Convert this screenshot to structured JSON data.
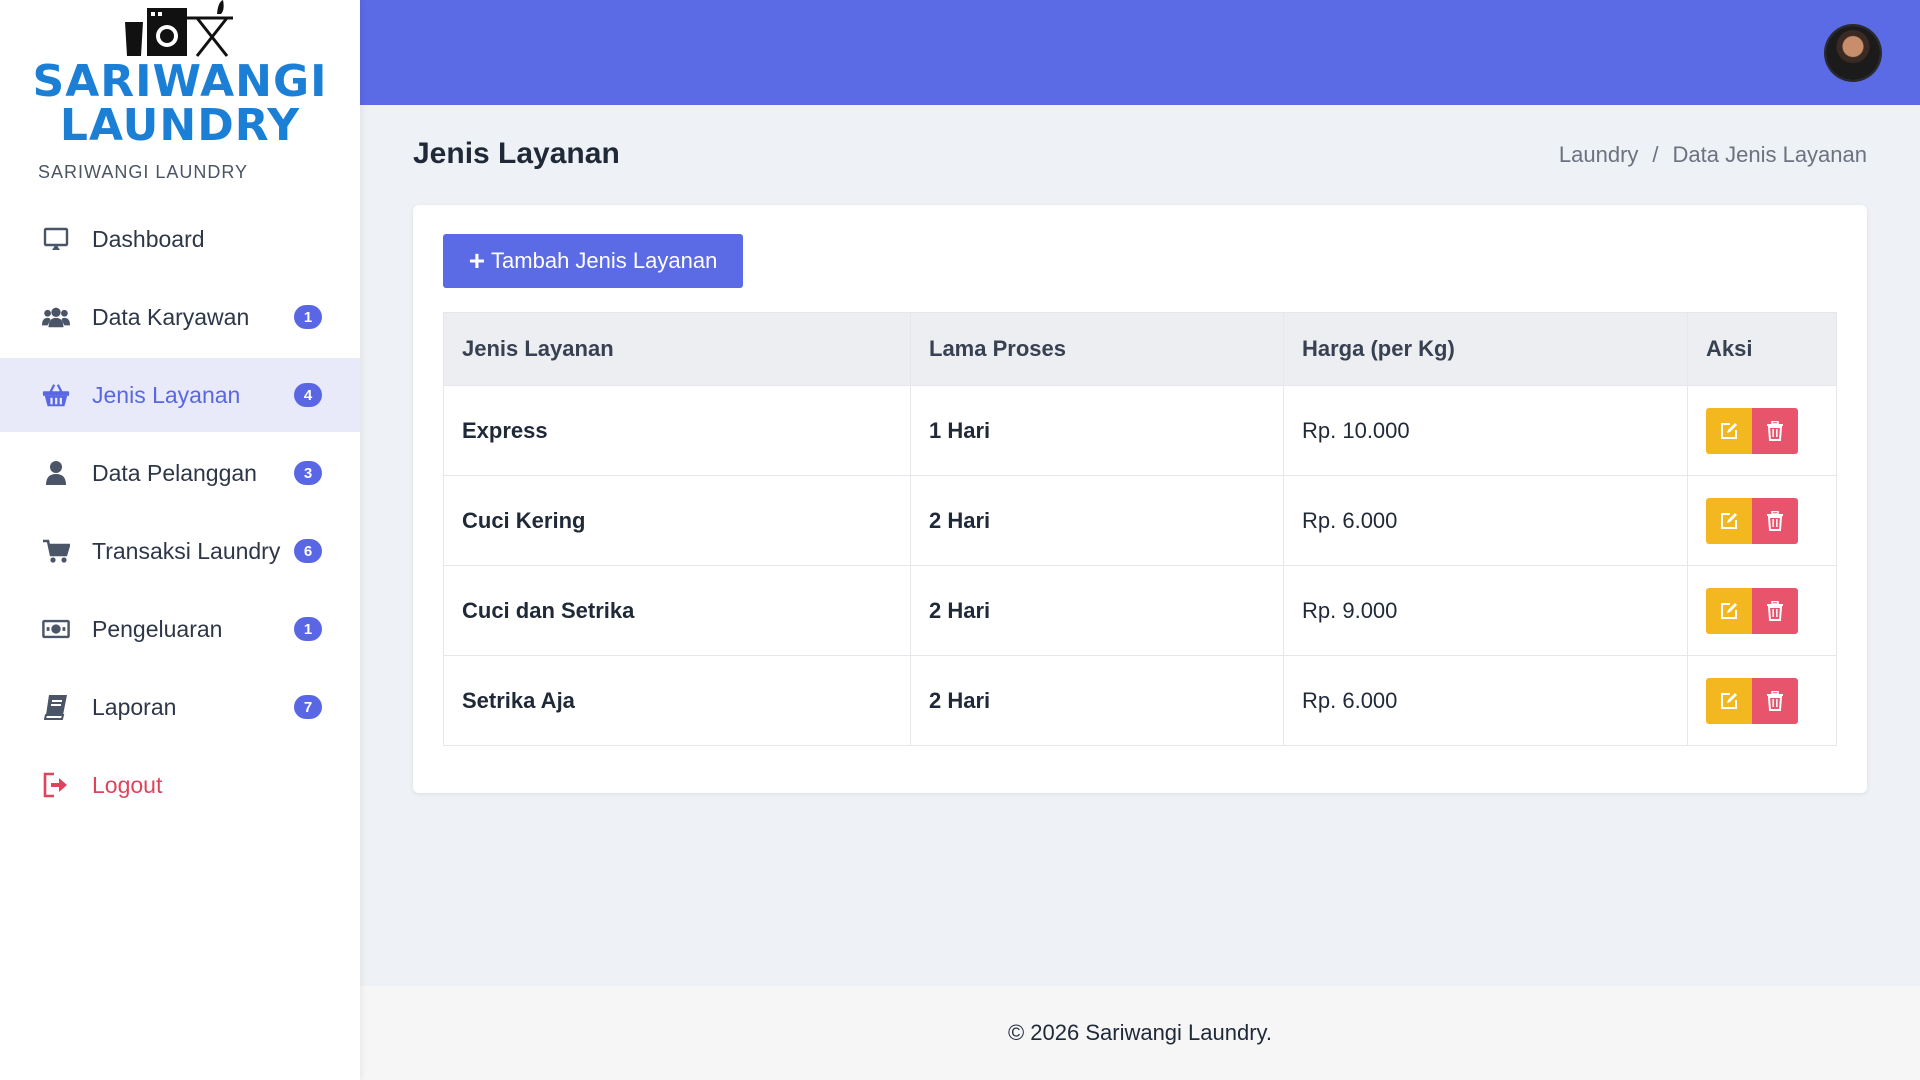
{
  "brand": {
    "wordmark_line1": "SARIWANGI",
    "wordmark_line2": "LAUNDRY",
    "subtitle": "SARIWANGI LAUNDRY",
    "logo_icon": "laundry-machine-iron-icon"
  },
  "sidebar": {
    "items": [
      {
        "label": "Dashboard",
        "icon": "monitor-icon",
        "badge": ""
      },
      {
        "label": "Data Karyawan",
        "icon": "users-icon",
        "badge": "1"
      },
      {
        "label": "Jenis Layanan",
        "icon": "basket-icon",
        "badge": "4",
        "active": true
      },
      {
        "label": "Data Pelanggan",
        "icon": "user-icon",
        "badge": "3"
      },
      {
        "label": "Transaksi Laundry",
        "icon": "cart-icon",
        "badge": "6"
      },
      {
        "label": "Pengeluaran",
        "icon": "money-icon",
        "badge": "1"
      },
      {
        "label": "Laporan",
        "icon": "book-icon",
        "badge": "7"
      },
      {
        "label": "Logout",
        "icon": "logout-icon",
        "badge": ""
      }
    ]
  },
  "header": {
    "avatar_icon": "user-avatar"
  },
  "page": {
    "title": "Jenis Layanan",
    "breadcrumb": [
      "Laundry",
      "/",
      "Data Jenis Layanan"
    ]
  },
  "toolbar": {
    "add_plus": "+",
    "add_label": "Tambah Jenis Layanan"
  },
  "table": {
    "columns": [
      "Jenis Layanan",
      "Lama Proses",
      "Harga (per Kg)",
      "Aksi"
    ],
    "rows": [
      {
        "name": "Express",
        "duration": "1 Hari",
        "price": "Rp. 10.000"
      },
      {
        "name": "Cuci Kering",
        "duration": "2 Hari",
        "price": "Rp. 6.000"
      },
      {
        "name": "Cuci dan Setrika",
        "duration": "2 Hari",
        "price": "Rp. 9.000"
      },
      {
        "name": "Setrika Aja",
        "duration": "2 Hari",
        "price": "Rp. 6.000"
      }
    ]
  },
  "footer": {
    "text": "© 2026 Sariwangi Laundry."
  },
  "colors": {
    "primary": "#5b6ae5",
    "brand_blue": "#1c7fd6",
    "edit": "#f3b81f",
    "delete": "#e8546b",
    "logout": "#e0445a"
  }
}
